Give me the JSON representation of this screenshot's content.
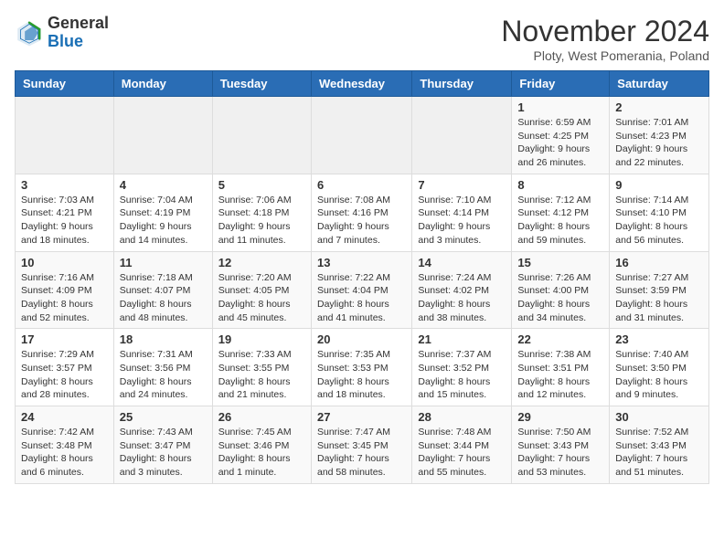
{
  "logo": {
    "general": "General",
    "blue": "Blue"
  },
  "header": {
    "month": "November 2024",
    "location": "Ploty, West Pomerania, Poland"
  },
  "weekdays": [
    "Sunday",
    "Monday",
    "Tuesday",
    "Wednesday",
    "Thursday",
    "Friday",
    "Saturday"
  ],
  "weeks": [
    [
      {
        "day": "",
        "info": ""
      },
      {
        "day": "",
        "info": ""
      },
      {
        "day": "",
        "info": ""
      },
      {
        "day": "",
        "info": ""
      },
      {
        "day": "",
        "info": ""
      },
      {
        "day": "1",
        "info": "Sunrise: 6:59 AM\nSunset: 4:25 PM\nDaylight: 9 hours and 26 minutes."
      },
      {
        "day": "2",
        "info": "Sunrise: 7:01 AM\nSunset: 4:23 PM\nDaylight: 9 hours and 22 minutes."
      }
    ],
    [
      {
        "day": "3",
        "info": "Sunrise: 7:03 AM\nSunset: 4:21 PM\nDaylight: 9 hours and 18 minutes."
      },
      {
        "day": "4",
        "info": "Sunrise: 7:04 AM\nSunset: 4:19 PM\nDaylight: 9 hours and 14 minutes."
      },
      {
        "day": "5",
        "info": "Sunrise: 7:06 AM\nSunset: 4:18 PM\nDaylight: 9 hours and 11 minutes."
      },
      {
        "day": "6",
        "info": "Sunrise: 7:08 AM\nSunset: 4:16 PM\nDaylight: 9 hours and 7 minutes."
      },
      {
        "day": "7",
        "info": "Sunrise: 7:10 AM\nSunset: 4:14 PM\nDaylight: 9 hours and 3 minutes."
      },
      {
        "day": "8",
        "info": "Sunrise: 7:12 AM\nSunset: 4:12 PM\nDaylight: 8 hours and 59 minutes."
      },
      {
        "day": "9",
        "info": "Sunrise: 7:14 AM\nSunset: 4:10 PM\nDaylight: 8 hours and 56 minutes."
      }
    ],
    [
      {
        "day": "10",
        "info": "Sunrise: 7:16 AM\nSunset: 4:09 PM\nDaylight: 8 hours and 52 minutes."
      },
      {
        "day": "11",
        "info": "Sunrise: 7:18 AM\nSunset: 4:07 PM\nDaylight: 8 hours and 48 minutes."
      },
      {
        "day": "12",
        "info": "Sunrise: 7:20 AM\nSunset: 4:05 PM\nDaylight: 8 hours and 45 minutes."
      },
      {
        "day": "13",
        "info": "Sunrise: 7:22 AM\nSunset: 4:04 PM\nDaylight: 8 hours and 41 minutes."
      },
      {
        "day": "14",
        "info": "Sunrise: 7:24 AM\nSunset: 4:02 PM\nDaylight: 8 hours and 38 minutes."
      },
      {
        "day": "15",
        "info": "Sunrise: 7:26 AM\nSunset: 4:00 PM\nDaylight: 8 hours and 34 minutes."
      },
      {
        "day": "16",
        "info": "Sunrise: 7:27 AM\nSunset: 3:59 PM\nDaylight: 8 hours and 31 minutes."
      }
    ],
    [
      {
        "day": "17",
        "info": "Sunrise: 7:29 AM\nSunset: 3:57 PM\nDaylight: 8 hours and 28 minutes."
      },
      {
        "day": "18",
        "info": "Sunrise: 7:31 AM\nSunset: 3:56 PM\nDaylight: 8 hours and 24 minutes."
      },
      {
        "day": "19",
        "info": "Sunrise: 7:33 AM\nSunset: 3:55 PM\nDaylight: 8 hours and 21 minutes."
      },
      {
        "day": "20",
        "info": "Sunrise: 7:35 AM\nSunset: 3:53 PM\nDaylight: 8 hours and 18 minutes."
      },
      {
        "day": "21",
        "info": "Sunrise: 7:37 AM\nSunset: 3:52 PM\nDaylight: 8 hours and 15 minutes."
      },
      {
        "day": "22",
        "info": "Sunrise: 7:38 AM\nSunset: 3:51 PM\nDaylight: 8 hours and 12 minutes."
      },
      {
        "day": "23",
        "info": "Sunrise: 7:40 AM\nSunset: 3:50 PM\nDaylight: 8 hours and 9 minutes."
      }
    ],
    [
      {
        "day": "24",
        "info": "Sunrise: 7:42 AM\nSunset: 3:48 PM\nDaylight: 8 hours and 6 minutes."
      },
      {
        "day": "25",
        "info": "Sunrise: 7:43 AM\nSunset: 3:47 PM\nDaylight: 8 hours and 3 minutes."
      },
      {
        "day": "26",
        "info": "Sunrise: 7:45 AM\nSunset: 3:46 PM\nDaylight: 8 hours and 1 minute."
      },
      {
        "day": "27",
        "info": "Sunrise: 7:47 AM\nSunset: 3:45 PM\nDaylight: 7 hours and 58 minutes."
      },
      {
        "day": "28",
        "info": "Sunrise: 7:48 AM\nSunset: 3:44 PM\nDaylight: 7 hours and 55 minutes."
      },
      {
        "day": "29",
        "info": "Sunrise: 7:50 AM\nSunset: 3:43 PM\nDaylight: 7 hours and 53 minutes."
      },
      {
        "day": "30",
        "info": "Sunrise: 7:52 AM\nSunset: 3:43 PM\nDaylight: 7 hours and 51 minutes."
      }
    ]
  ]
}
